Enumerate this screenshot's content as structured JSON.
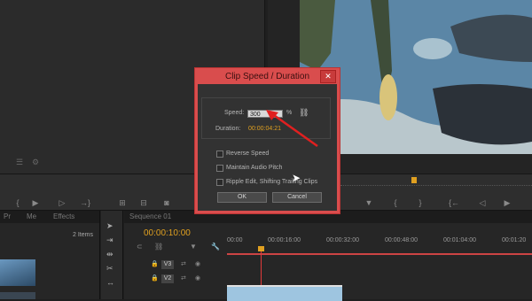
{
  "dialog": {
    "title": "Clip Speed / Duration",
    "close_label": "✕",
    "speed_label": "Speed:",
    "speed_value": "300",
    "speed_unit": "%",
    "duration_label": "Duration:",
    "duration_value": "00:00:04:21",
    "reverse_speed_label": "Reverse Speed",
    "maintain_audio_label": "Maintain Audio Pitch",
    "ripple_edit_label": "Ripple Edit, Shifting Trailing Clips",
    "ok_label": "OK",
    "cancel_label": "Cancel"
  },
  "project": {
    "items_count": "2 Items"
  },
  "timeline": {
    "current_time": "00:00:10:00",
    "ruler": [
      "00:00",
      "00:00:16:00",
      "00:00:32:00",
      "00:00:48:00",
      "00:01:04:00",
      "00:01:20"
    ],
    "tracks": [
      "V3",
      "V2"
    ]
  },
  "colors": {
    "dialog_red": "#d94d4d",
    "timecode_orange": "#e0a020",
    "playhead": "#e23a3a"
  }
}
